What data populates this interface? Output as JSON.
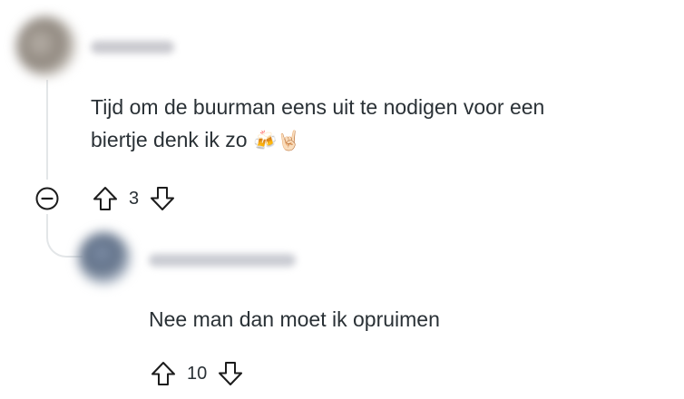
{
  "comments": [
    {
      "username": "user",
      "text_line1": "Tijd om de buurman eens uit te nodigen voor een",
      "text_line2": "biertje denk ik zo",
      "emoji_beer": "🍻",
      "emoji_hand": "🤘🏻",
      "score": "3"
    },
    {
      "username": "reply-user",
      "text": "Nee man dan moet ik opruimen",
      "score": "10"
    }
  ],
  "icons": {
    "collapse": "minus-circle-icon",
    "upvote": "arrow-up-icon",
    "downvote": "arrow-down-icon"
  },
  "colors": {
    "text": "#2a3136",
    "thread_line": "#e3e6e8",
    "icon": "#1c1c1c"
  }
}
